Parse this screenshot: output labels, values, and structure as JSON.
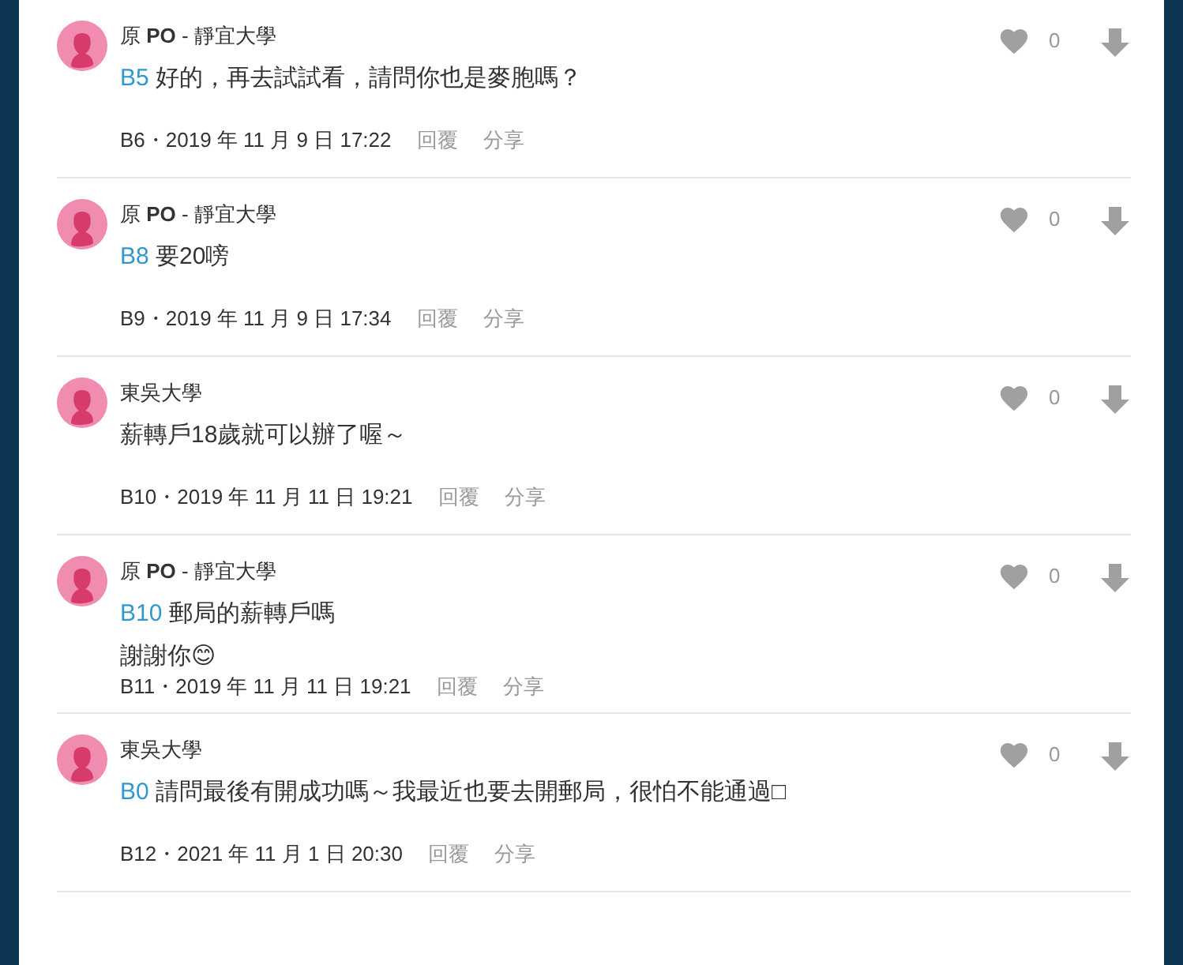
{
  "comments": [
    {
      "author": "原 **PO** - 靜宜大學",
      "lines": [
        {
          "reply_to": "B5",
          "text": "好的，再去試試看，請問你也是麥胞嗎？"
        }
      ],
      "meta": "B6・2019 年 11 月 9 日 17:22",
      "actions": [
        "回覆",
        "分享"
      ],
      "likes": "0",
      "liked": false
    },
    {
      "author": "原 **PO** - 靜宜大學",
      "lines": [
        {
          "reply_to": "B8",
          "text": "要20嗙"
        }
      ],
      "meta": "B9・2019 年 11 月 9 日 17:34",
      "actions": [
        "回覆",
        "分享"
      ],
      "likes": "0",
      "liked": false
    },
    {
      "author": "東吳大學",
      "lines": [
        {
          "text": "薪轉戶18歲就可以辦了喔～"
        }
      ],
      "meta": "B10・2019 年 11 月 11 日 19:21",
      "actions": [
        "回覆",
        "分享"
      ],
      "likes": "0",
      "liked": false
    },
    {
      "author": "原 **PO** - 靜宜大學",
      "lines": [
        {
          "reply_to": "B10",
          "text": "郵局的薪轉戶嗎"
        },
        {
          "text": "謝謝你😊"
        }
      ],
      "meta": "B11・2019 年 11 月 11 日 19:21",
      "actions": [
        "回覆",
        "分享"
      ],
      "likes": "0",
      "liked": false
    },
    {
      "author": "東吳大學",
      "lines": [
        {
          "reply_to": "B0",
          "text": "請問最後有開成功嗎～我最近也要去開郵局，很怕不能通過□"
        }
      ],
      "meta": "B12・2021 年 11 月 1 日 20:30",
      "actions": [
        "回覆",
        "分享"
      ],
      "likes": "0",
      "liked": false
    }
  ]
}
